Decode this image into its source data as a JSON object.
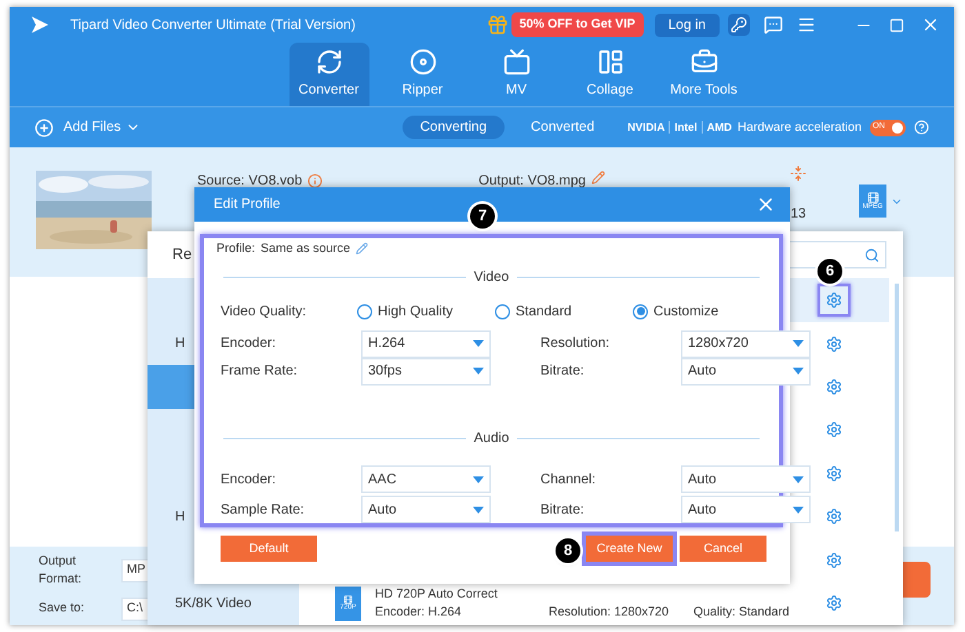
{
  "window": {
    "title": "Tipard Video Converter Ultimate (Trial Version)",
    "promo": "50% OFF to Get VIP",
    "login": "Log in"
  },
  "nav_tabs": [
    {
      "label": "Converter",
      "selected": true
    },
    {
      "label": "Ripper",
      "selected": false
    },
    {
      "label": "MV",
      "selected": false
    },
    {
      "label": "Collage",
      "selected": false
    },
    {
      "label": "More Tools",
      "selected": false
    }
  ],
  "toolbar": {
    "add_files": "Add Files",
    "status_tabs": [
      {
        "label": "Converting",
        "selected": true
      },
      {
        "label": "Converted",
        "selected": false
      }
    ],
    "vendors": [
      "NVIDIA",
      "Intel",
      "AMD"
    ],
    "hardware_label": "Hardware acceleration",
    "toggle": {
      "on": true,
      "label": "ON"
    }
  },
  "file": {
    "source": "Source: VO8.vob",
    "output": "Output: VO8.mpg",
    "format": "MPEG",
    "partial": "13"
  },
  "bottom_bar": {
    "output_format_label": "Output Format:",
    "output_format_value": "MP",
    "save_to_label": "Save to:",
    "save_to_value": "C:\\"
  },
  "profile_panel": {
    "tab": "Re",
    "categories": [
      {
        "selected": false
      },
      {
        "label": "H",
        "selected": false
      },
      {
        "selected": true
      },
      {
        "selected": false
      },
      {
        "selected": false
      },
      {
        "label": "H",
        "selected": false
      },
      {
        "selected": false
      },
      {
        "label": "5K/8K Video",
        "selected": false
      }
    ],
    "presets": [
      {
        "selected": true
      },
      {
        "selected": false
      },
      {
        "selected": false
      },
      {
        "selected": false
      },
      {
        "selected": false
      },
      {
        "selected": false
      },
      {
        "selected": false
      },
      {
        "selected": false,
        "badge": "720P",
        "name": "HD 720P Auto Correct",
        "encoder": "Encoder: H.264",
        "resolution": "Resolution: 1280x720",
        "quality": "Quality: Standard"
      }
    ]
  },
  "edit_profile": {
    "title": "Edit Profile",
    "profile_label": "Profile:",
    "profile_value": "Same as source",
    "video": {
      "title": "Video",
      "quality_label": "Video Quality:",
      "quality_options": [
        {
          "label": "High Quality",
          "selected": false
        },
        {
          "label": "Standard",
          "selected": false
        },
        {
          "label": "Customize",
          "selected": true
        }
      ],
      "fields": [
        {
          "label": "Encoder:",
          "value": "H.264"
        },
        {
          "label": "Resolution:",
          "value": "1280x720"
        },
        {
          "label": "Frame Rate:",
          "value": "30fps"
        },
        {
          "label": "Bitrate:",
          "value": "Auto"
        }
      ]
    },
    "audio": {
      "title": "Audio",
      "fields": [
        {
          "label": "Encoder:",
          "value": "AAC"
        },
        {
          "label": "Channel:",
          "value": "Auto"
        },
        {
          "label": "Sample Rate:",
          "value": "Auto"
        },
        {
          "label": "Bitrate:",
          "value": "Auto"
        }
      ]
    },
    "buttons": [
      {
        "label": "Default",
        "highlighted": false
      },
      {
        "label": "Create New",
        "highlighted": true
      },
      {
        "label": "Cancel",
        "highlighted": false
      }
    ]
  },
  "callouts": [
    "6",
    "7",
    "8"
  ]
}
